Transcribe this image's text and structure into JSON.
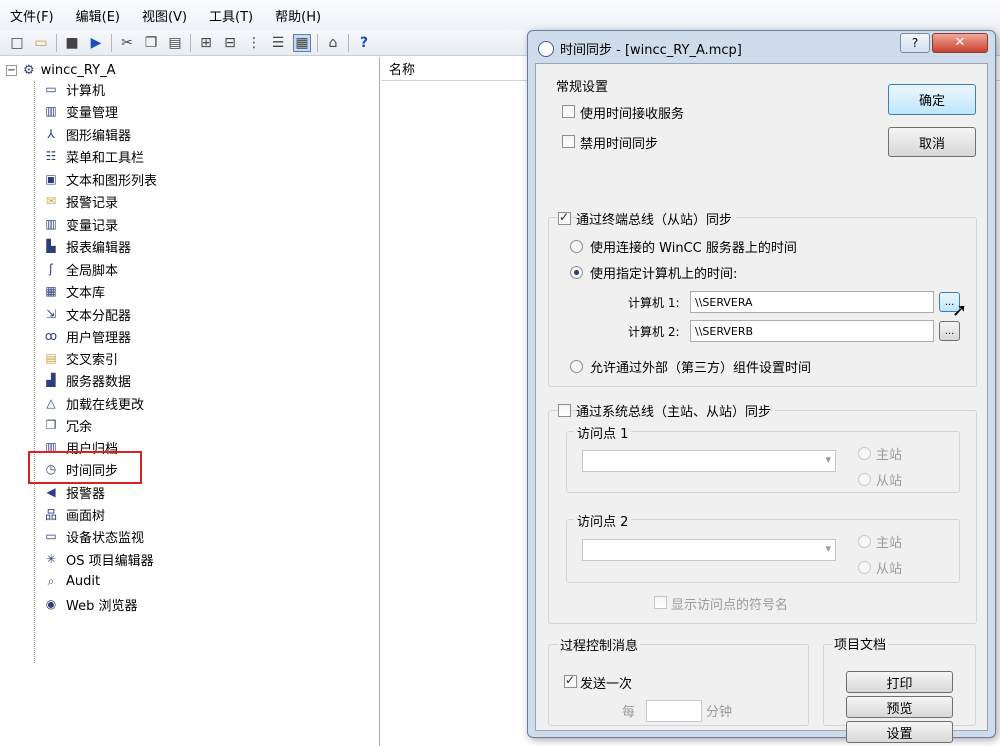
{
  "menu": [
    "文件(F)",
    "编辑(E)",
    "视图(V)",
    "工具(T)",
    "帮助(H)"
  ],
  "tree": {
    "root": "wincc_RY_A",
    "items": [
      {
        "label": "计算机",
        "icon": "computer-icon"
      },
      {
        "label": "变量管理",
        "icon": "tag-management-icon"
      },
      {
        "label": "图形编辑器",
        "icon": "graphics-designer-icon"
      },
      {
        "label": "菜单和工具栏",
        "icon": "menu-toolbar-icon"
      },
      {
        "label": "文本和图形列表",
        "icon": "text-graphic-list-icon"
      },
      {
        "label": "报警记录",
        "icon": "alarm-logging-icon"
      },
      {
        "label": "变量记录",
        "icon": "tag-logging-icon"
      },
      {
        "label": "报表编辑器",
        "icon": "report-designer-icon"
      },
      {
        "label": "全局脚本",
        "icon": "global-script-icon"
      },
      {
        "label": "文本库",
        "icon": "text-library-icon"
      },
      {
        "label": "文本分配器",
        "icon": "text-distributor-icon"
      },
      {
        "label": "用户管理器",
        "icon": "user-administrator-icon"
      },
      {
        "label": "交叉索引",
        "icon": "cross-reference-icon"
      },
      {
        "label": "服务器数据",
        "icon": "server-data-icon"
      },
      {
        "label": "加载在线更改",
        "icon": "load-online-changes-icon"
      },
      {
        "label": "冗余",
        "icon": "redundancy-icon"
      },
      {
        "label": "用户归档",
        "icon": "user-archive-icon"
      },
      {
        "label": "时间同步",
        "icon": "clock-icon"
      },
      {
        "label": "报警器",
        "icon": "horn-icon"
      },
      {
        "label": "画面树",
        "icon": "picture-tree-icon"
      },
      {
        "label": "设备状态监视",
        "icon": "device-status-icon"
      },
      {
        "label": "OS 项目编辑器",
        "icon": "os-project-editor-icon"
      },
      {
        "label": "Audit",
        "icon": "audit-icon"
      },
      {
        "label": "Web 浏览器",
        "icon": "globe-icon"
      }
    ]
  },
  "list": {
    "header_name": "名称"
  },
  "dialog": {
    "title": "时间同步 - [wincc_RY_A.mcp]",
    "help": "?",
    "close": "✕",
    "general": {
      "title": "常规设置",
      "use_receive_service": "使用时间接收服务",
      "disable_sync": "禁用时间同步"
    },
    "ok": "确定",
    "cancel": "取消",
    "terminal_bus": {
      "title": "通过终端总线（从站）同步",
      "opt_connected_server": "使用连接的 WinCC 服务器上的时间",
      "opt_specified_computer": "使用指定计算机上的时间:",
      "computer1_label": "计算机 1:",
      "computer1_value": "\\\\SERVERA",
      "computer2_label": "计算机 2:",
      "computer2_value": "\\\\SERVERB",
      "browse": "...",
      "opt_external": "允许通过外部（第三方）组件设置时间"
    },
    "system_bus": {
      "title": "通过系统总线（主站、从站）同步",
      "access_point1": "访问点 1",
      "access_point2": "访问点 2",
      "master": "主站",
      "slave": "从站",
      "show_symbolic": "显示访问点的符号名"
    },
    "process_msg": {
      "title": "过程控制消息",
      "send_once": "发送一次",
      "every": "每",
      "minutes": "分钟"
    },
    "project_doc": {
      "title": "项目文档",
      "print": "打印",
      "preview": "预览",
      "setup": "设置"
    }
  }
}
